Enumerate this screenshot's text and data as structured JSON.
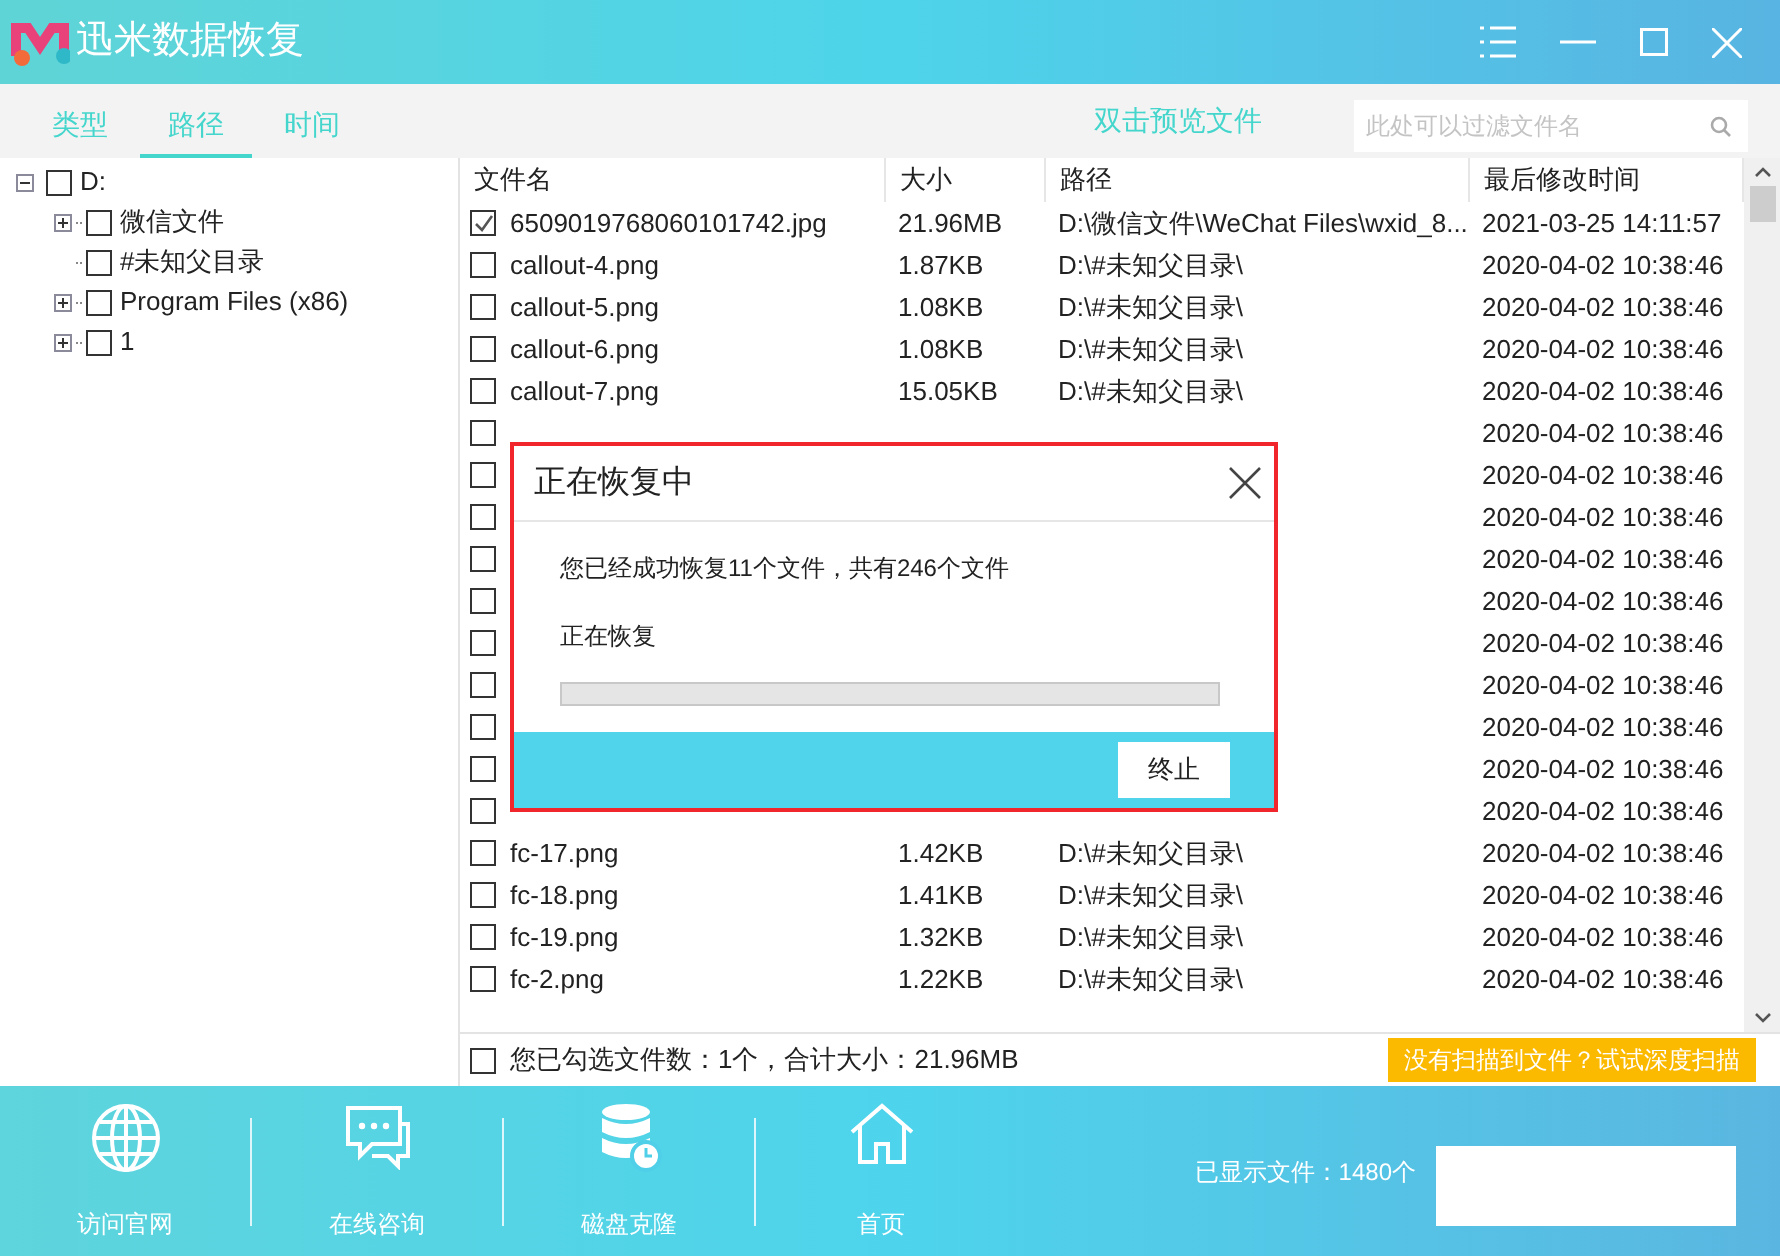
{
  "window": {
    "title": "迅米数据恢复"
  },
  "tabs": [
    {
      "label": "类型",
      "selected": false
    },
    {
      "label": "路径",
      "selected": true
    },
    {
      "label": "时间",
      "selected": false
    }
  ],
  "preview_hint": "双击预览文件",
  "search": {
    "placeholder": "此处可以过滤文件名"
  },
  "tree": [
    {
      "label": "D:",
      "checked": false,
      "expanded": true,
      "children": [
        {
          "label": "微信文件",
          "checked": false,
          "expanded": false,
          "has_children": true
        },
        {
          "label": "#未知父目录",
          "checked": false,
          "has_children": false
        },
        {
          "label": "Program Files (x86)",
          "checked": false,
          "expanded": false,
          "has_children": true
        },
        {
          "label": "1",
          "checked": false,
          "expanded": false,
          "has_children": true
        }
      ]
    }
  ],
  "table": {
    "columns": [
      "文件名",
      "大小",
      "路径",
      "最后修改时间"
    ],
    "rows": [
      {
        "checked": true,
        "name": "6509019768060101742.jpg",
        "size": "21.96MB",
        "path": "D:\\微信文件\\WeChat Files\\wxid_8...",
        "modified": "2021-03-25 14:11:57"
      },
      {
        "checked": false,
        "name": "callout-4.png",
        "size": "1.87KB",
        "path": "D:\\#未知父目录\\",
        "modified": "2020-04-02 10:38:46"
      },
      {
        "checked": false,
        "name": "callout-5.png",
        "size": "1.08KB",
        "path": "D:\\#未知父目录\\",
        "modified": "2020-04-02 10:38:46"
      },
      {
        "checked": false,
        "name": "callout-6.png",
        "size": "1.08KB",
        "path": "D:\\#未知父目录\\",
        "modified": "2020-04-02 10:38:46"
      },
      {
        "checked": false,
        "name": "callout-7.png",
        "size": "15.05KB",
        "path": "D:\\#未知父目录\\",
        "modified": "2020-04-02 10:38:46"
      },
      {
        "checked": false,
        "modified": "2020-04-02 10:38:46"
      },
      {
        "checked": false,
        "modified": "2020-04-02 10:38:46"
      },
      {
        "checked": false,
        "modified": "2020-04-02 10:38:46"
      },
      {
        "checked": false,
        "modified": "2020-04-02 10:38:46"
      },
      {
        "checked": false,
        "modified": "2020-04-02 10:38:46"
      },
      {
        "checked": false,
        "modified": "2020-04-02 10:38:46"
      },
      {
        "checked": false,
        "modified": "2020-04-02 10:38:46"
      },
      {
        "checked": false,
        "modified": "2020-04-02 10:38:46"
      },
      {
        "checked": false,
        "modified": "2020-04-02 10:38:46"
      },
      {
        "checked": false,
        "modified": "2020-04-02 10:38:46"
      },
      {
        "checked": false,
        "name": "fc-17.png",
        "size": "1.42KB",
        "path": "D:\\#未知父目录\\",
        "modified": "2020-04-02 10:38:46"
      },
      {
        "checked": false,
        "name": "fc-18.png",
        "size": "1.41KB",
        "path": "D:\\#未知父目录\\",
        "modified": "2020-04-02 10:38:46"
      },
      {
        "checked": false,
        "name": "fc-19.png",
        "size": "1.32KB",
        "path": "D:\\#未知父目录\\",
        "modified": "2020-04-02 10:38:46"
      },
      {
        "checked": false,
        "name": "fc-2.png",
        "size": "1.22KB",
        "path": "D:\\#未知父目录\\",
        "modified": "2020-04-02 10:38:46"
      }
    ]
  },
  "selection": {
    "checked": false,
    "summary": "您已勾选文件数：1个，合计大小：21.96MB"
  },
  "deep_scan_button": "没有扫描到文件？试试深度扫描",
  "dialog": {
    "title": "正在恢复中",
    "message": "您已经成功恢复11个文件，共有246个文件",
    "status": "正在恢复",
    "level": 0,
    "button": "终止"
  },
  "footer": {
    "items": [
      {
        "kind": "globe",
        "label": "访问官网"
      },
      {
        "kind": "chat",
        "label": "在线咨询"
      },
      {
        "kind": "disk",
        "label": "磁盘克隆"
      },
      {
        "kind": "home",
        "label": "首页"
      }
    ],
    "shown_files": "已显示文件：1480个"
  }
}
